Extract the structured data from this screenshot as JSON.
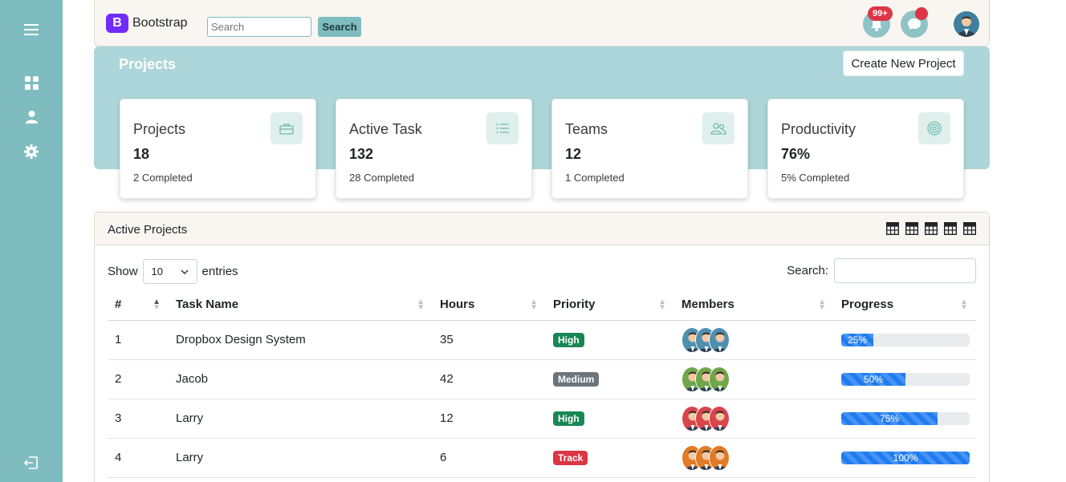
{
  "brand": {
    "name": "Bootstrap",
    "logo_letter": "B"
  },
  "topbar": {
    "search_placeholder": "Search",
    "search_button": "Search",
    "notification_count": "99+"
  },
  "hero": {
    "title": "Projects",
    "create_button": "Create New Project"
  },
  "cards": [
    {
      "title": "Projects",
      "value": "18",
      "sub": "2 Completed",
      "icon": "briefcase-icon"
    },
    {
      "title": "Active Task",
      "value": "132",
      "sub": "28 Completed",
      "icon": "list-icon"
    },
    {
      "title": "Teams",
      "value": "12",
      "sub": "1 Completed",
      "icon": "people-icon"
    },
    {
      "title": "Productivity",
      "value": "76%",
      "sub": "5% Completed",
      "icon": "target-icon"
    }
  ],
  "active_projects": {
    "title": "Active Projects",
    "show_label": "Show",
    "entries_value": "10",
    "entries_label": "entries",
    "search_label": "Search:",
    "columns": [
      "#",
      "Task Name",
      "Hours",
      "Priority",
      "Members",
      "Progress"
    ],
    "rows": [
      {
        "num": "1",
        "task": "Dropbox Design System",
        "hours": "35",
        "priority": "High",
        "priority_color": "#198754",
        "member_color": "#4f8fb0",
        "progress": 25,
        "progress_label": "25%"
      },
      {
        "num": "2",
        "task": "Jacob",
        "hours": "42",
        "priority": "Medium",
        "priority_color": "#6c757d",
        "member_color": "#6fa64a",
        "progress": 50,
        "progress_label": "50%"
      },
      {
        "num": "3",
        "task": "Larry",
        "hours": "12",
        "priority": "High",
        "priority_color": "#198754",
        "member_color": "#d9454a",
        "progress": 75,
        "progress_label": "75%"
      },
      {
        "num": "4",
        "task": "Larry",
        "hours": "6",
        "priority": "Track",
        "priority_color": "#dc3545",
        "member_color": "#e07b26",
        "progress": 100,
        "progress_label": "100%"
      }
    ]
  },
  "colors": {
    "sidebar": "#7fbcc0",
    "hero": "#acd6d9",
    "accent": "#7fbcc0"
  }
}
